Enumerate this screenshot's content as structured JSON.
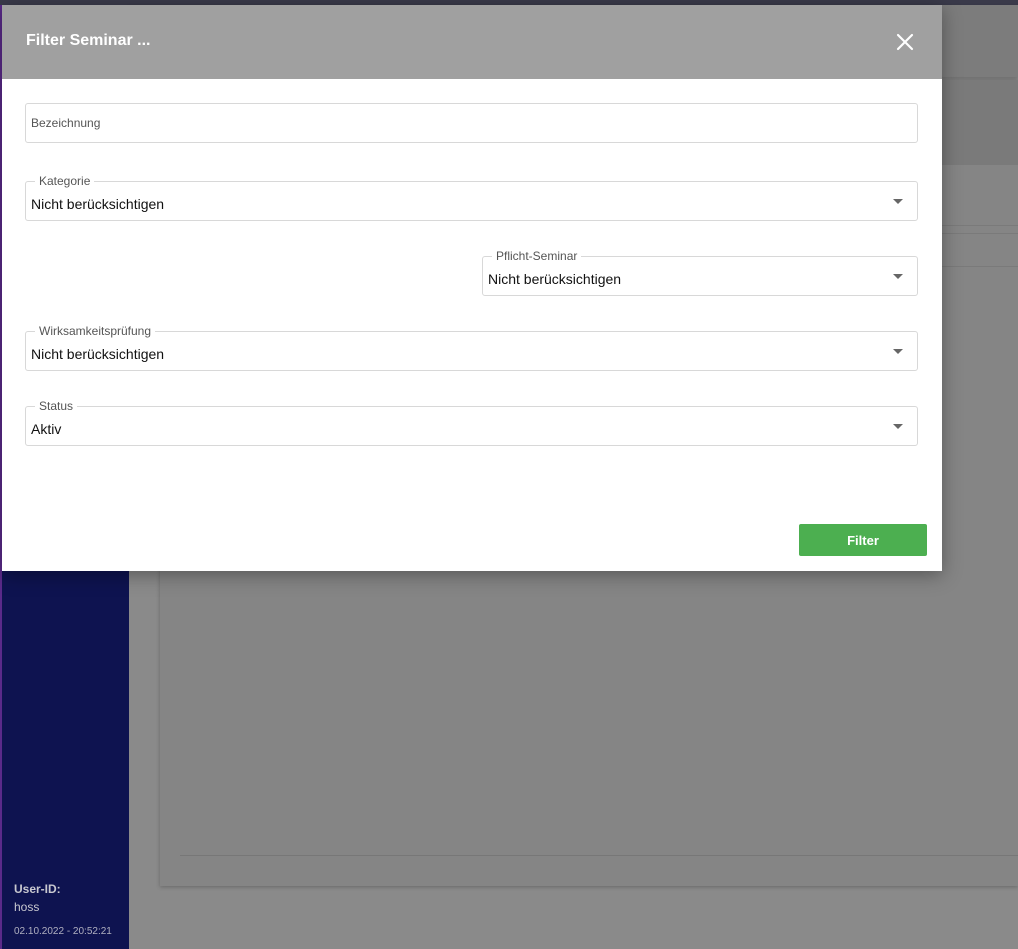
{
  "modal": {
    "title": "Filter Seminar ...",
    "fields": {
      "bezeichnung": {
        "placeholder": "Bezeichnung",
        "value": ""
      },
      "kategorie": {
        "label": "Kategorie",
        "value": "Nicht berücksichtigen"
      },
      "pflicht_seminar": {
        "label": "Pflicht-Seminar",
        "value": "Nicht berücksichtigen"
      },
      "wirksamkeitspruefung": {
        "label": "Wirksamkeitsprüfung",
        "value": "Nicht berücksichtigen"
      },
      "status": {
        "label": "Status",
        "value": "Aktiv"
      }
    },
    "filter_button": "Filter"
  },
  "sidebar": {
    "user_id_label": "User-ID:",
    "user_name": "hoss",
    "timestamp": "02.10.2022 - 20:52:21"
  },
  "icons": {
    "close": "close-icon",
    "dropdown": "chevron-down-icon"
  },
  "colors": {
    "modal_header": "#a0a0a0",
    "filter_button": "#4caf50",
    "sidebar": "#0e1350"
  }
}
